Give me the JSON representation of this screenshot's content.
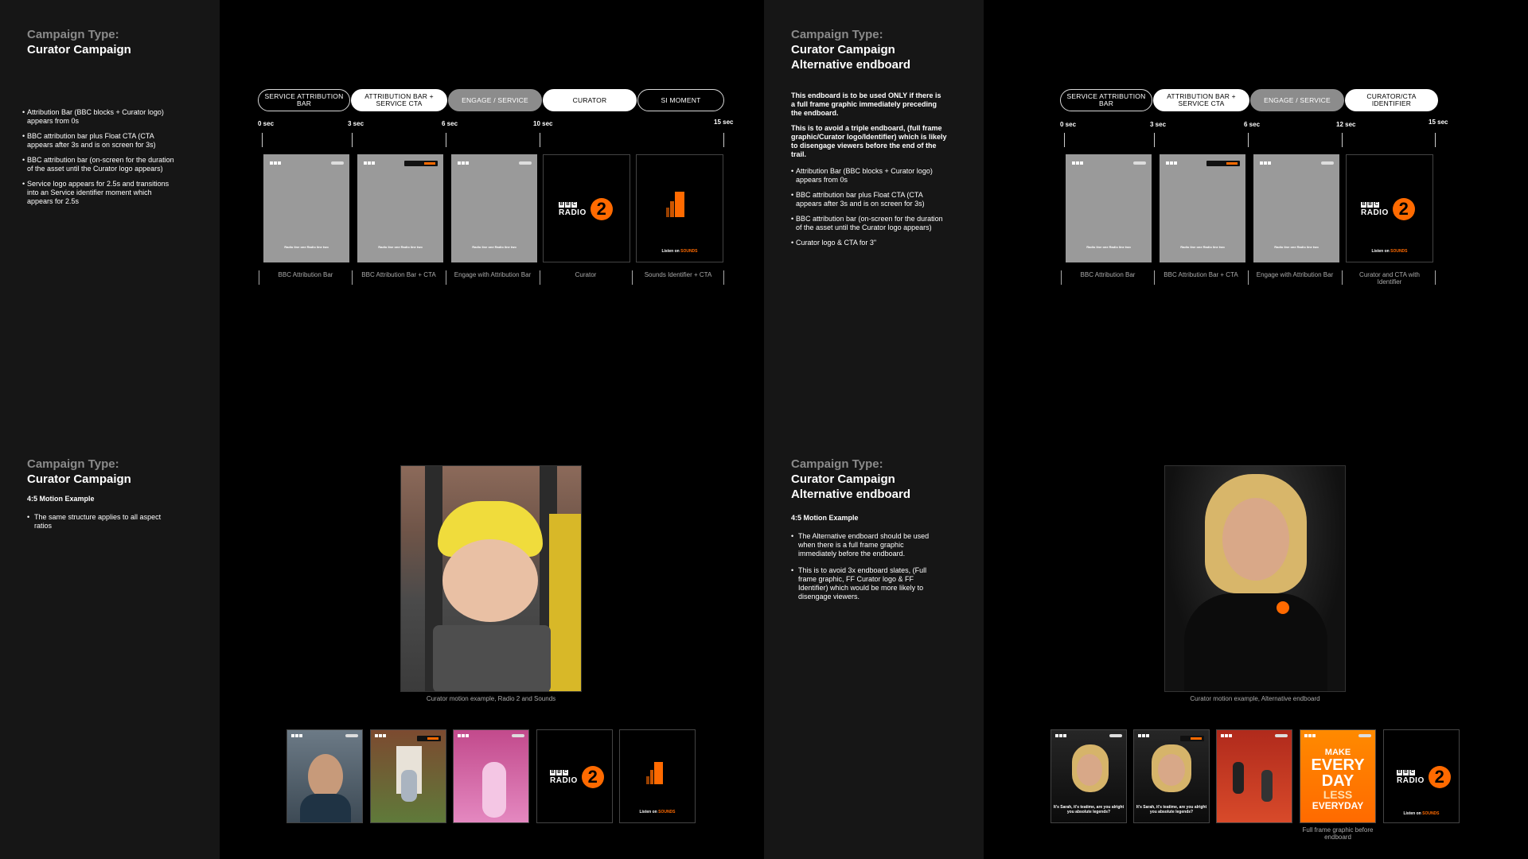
{
  "colors": {
    "accent": "#ff6a00",
    "panel": "#161616",
    "background": "#000000",
    "pill_grey": "#8c8c8c"
  },
  "section1": {
    "label": "Campaign Type:",
    "title": "Curator Campaign",
    "bullets": [
      "Attribution Bar (BBC blocks + Curator logo) appears from 0s",
      "BBC attribution bar plus Float CTA (CTA appears after 3s and is on screen for 3s)",
      "BBC attribution bar (on-screen for the duration of the asset until the Curator logo appears)",
      " Service logo appears for 2.5s and transitions into an Service identifier moment which appears for 2.5s"
    ],
    "pills": [
      "SERVICE ATTRIBUTION BAR",
      "ATTRIBUTION BAR + SERVICE CTA",
      "ENGAGE / SERVICE",
      "CURATOR",
      "SI MOMENT"
    ],
    "times": [
      "0 sec",
      "3 sec",
      "6 sec",
      "10 sec",
      "15 sec"
    ],
    "captions": [
      "BBC Attribution Bar",
      "BBC Attribution Bar + CTA",
      "Engage with Attribution Bar",
      "Curator",
      "Sounds Identifier + CTA"
    ],
    "tagline": "Radio line one Radio line two",
    "listen_prefix": "Listen on ",
    "listen_brand": "SOUNDS"
  },
  "section2": {
    "label": "Campaign Type:",
    "title_line1": "Curator Campaign",
    "title_line2": "Alternative endboard",
    "intro1": "This endboard is to be used ONLY if there is a full frame graphic immediately preceding the endboard.",
    "intro2": "This is to avoid a triple endboard, (full frame graphic/Curator logo/Identifier) which is likely to disengage viewers before the end of the trail.",
    "bullets": [
      "Attribution Bar (BBC blocks + Curator logo) appears from 0s",
      "BBC attribution bar plus Float CTA (CTA appears after 3s and is on screen for 3s)",
      "BBC attribution bar (on-screen for the duration of the asset until the Curator logo appears)",
      " Curator logo & CTA for 3\""
    ],
    "pills": [
      "SERVICE ATTRIBUTION BAR",
      "ATTRIBUTION BAR + SERVICE CTA",
      "ENGAGE / SERVICE",
      "CURATOR/CTA IDENTIFIER"
    ],
    "times": [
      "0 sec",
      "3 sec",
      "6 sec",
      "12 sec",
      "15 sec"
    ],
    "captions": [
      "BBC Attribution Bar",
      "BBC Attribution Bar + CTA",
      "Engage with Attribution Bar",
      "Curator and CTA with Identifier"
    ]
  },
  "section3": {
    "label": "Campaign Type:",
    "title": "Curator Campaign",
    "subtitle": "4:5 Motion Example",
    "bullets": [
      "The same structure applies to all aspect ratios"
    ],
    "photo_caption": "Curator motion example, Radio 2 and Sounds"
  },
  "section4": {
    "label": "Campaign Type:",
    "title_line1": "Curator Campaign",
    "title_line2": "Alternative endboard",
    "subtitle": "4:5 Motion Example",
    "bullets": [
      "The Alternative endboard should be used when there is a full frame graphic immediately before the endboard.",
      "This is to avoid 3x endboard slates, (Full frame graphic, FF Curator logo & FF Identifier) which would be more likely to disengage viewers."
    ],
    "photo_caption": "Curator motion example, Alternative endboard",
    "thumb_caption": "It's Sarah, it's teatime, are you alright you absolute legends?",
    "graphic_text": [
      "MAKE",
      "EVERY",
      "DAY",
      "LESS",
      "EVERYDAY"
    ],
    "graphic_caption": "Full frame graphic before endboard"
  },
  "radio2": {
    "bbc": [
      "B",
      "B",
      "C"
    ],
    "radio": "RADIO",
    "number": "2"
  }
}
